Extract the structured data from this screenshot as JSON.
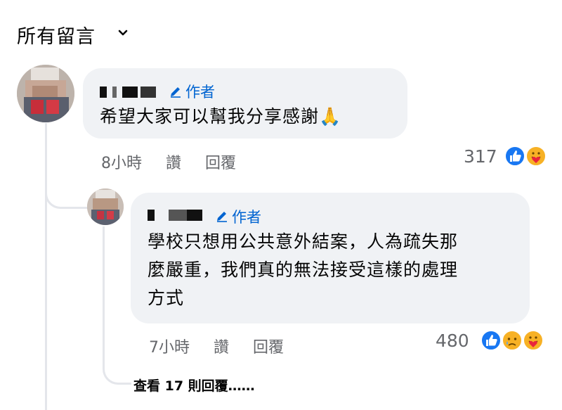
{
  "header": {
    "title": "所有留言",
    "dropdown_icon": "chevron-down-icon"
  },
  "comments": [
    {
      "author_label": "作者",
      "text": "希望大家可以幫我分享感謝",
      "emoji": "🙏",
      "time": "8小時",
      "like_label": "讚",
      "reply_label": "回覆",
      "reaction_count": "317",
      "reactions": [
        "like-icon",
        "care-icon"
      ]
    },
    {
      "author_label": "作者",
      "text_lines": [
        "學校只想用公共意外結案，人為疏失那",
        "麼嚴重，我們真的無法接受這樣的處理",
        "方式"
      ],
      "time": "7小時",
      "like_label": "讚",
      "reply_label": "回覆",
      "reaction_count": "480",
      "reactions": [
        "like-icon",
        "sad-icon",
        "care-icon"
      ]
    }
  ],
  "view_more": "查看 17 則回覆……",
  "colors": {
    "accent": "#0064d1",
    "bubble": "#f0f2f5",
    "meta": "#65676b",
    "line": "#e4e6eb"
  }
}
